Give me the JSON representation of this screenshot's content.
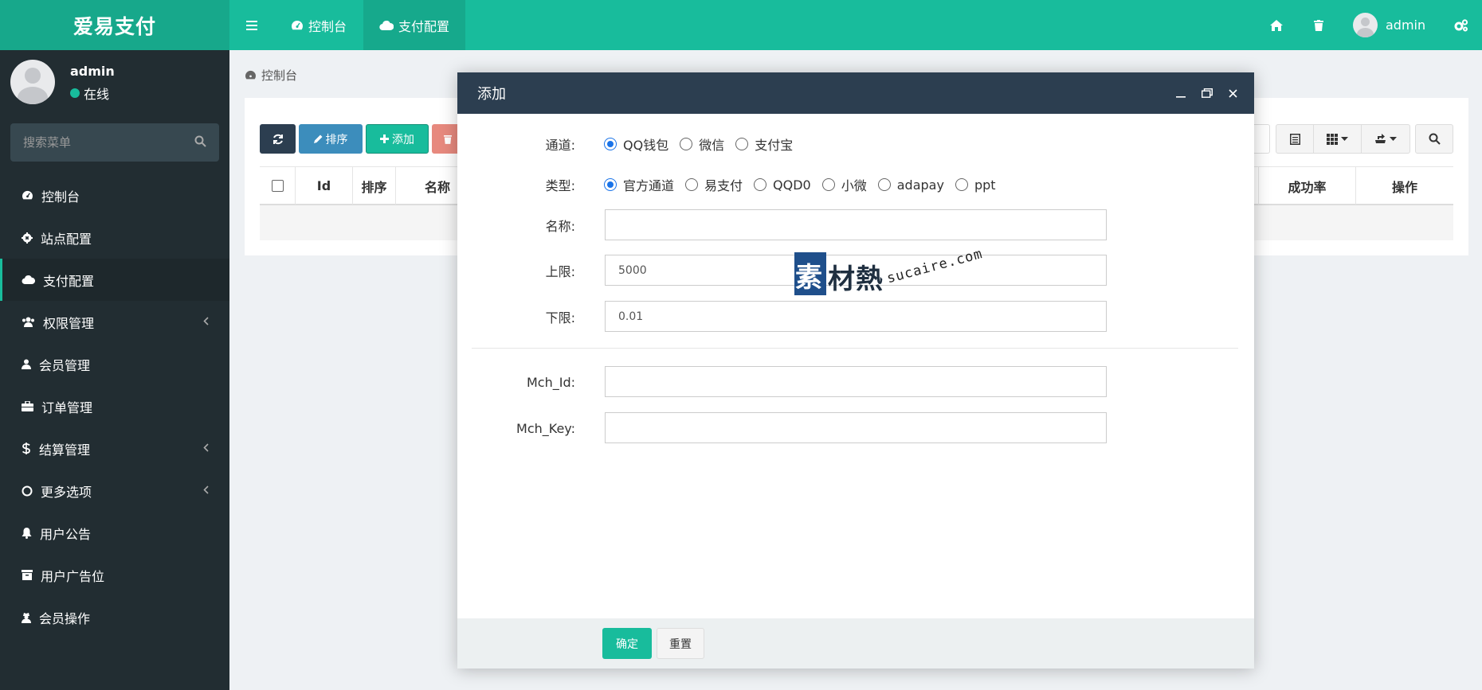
{
  "app": {
    "title": "爱易支付"
  },
  "topbar": {
    "tabs": [
      {
        "label": "控制台",
        "icon": "dashboard-icon"
      },
      {
        "label": "支付配置",
        "icon": "cloud-icon"
      }
    ],
    "user_name": "admin"
  },
  "sidebar": {
    "user_name": "admin",
    "status": "在线",
    "search_placeholder": "搜索菜单",
    "items": [
      {
        "label": "控制台",
        "icon": "dashboard-icon"
      },
      {
        "label": "站点配置",
        "icon": "gear-icon"
      },
      {
        "label": "支付配置",
        "icon": "cloud-icon",
        "active": true
      },
      {
        "label": "权限管理",
        "icon": "users-icon",
        "has_children": true
      },
      {
        "label": "会员管理",
        "icon": "user-icon"
      },
      {
        "label": "订单管理",
        "icon": "briefcase-icon"
      },
      {
        "label": "结算管理",
        "icon": "dollar-icon",
        "has_children": true
      },
      {
        "label": "更多选项",
        "icon": "circle-icon",
        "has_children": true
      },
      {
        "label": "用户公告",
        "icon": "bell-icon"
      },
      {
        "label": "用户广告位",
        "icon": "archive-icon"
      },
      {
        "label": "会员操作",
        "icon": "user-secret-icon"
      }
    ]
  },
  "breadcrumb": {
    "label": "控制台"
  },
  "toolbar": {
    "sort_label": "排序",
    "add_label": "添加"
  },
  "table": {
    "headers": [
      "Id",
      "排序",
      "名称",
      "成功率",
      "操作"
    ]
  },
  "modal": {
    "title": "添加",
    "channel": {
      "label": "通道:",
      "options": [
        "QQ钱包",
        "微信",
        "支付宝"
      ],
      "selected": "QQ钱包"
    },
    "type": {
      "label": "类型:",
      "options": [
        "官方通道",
        "易支付",
        "QQD0",
        "小微",
        "adapay",
        "ppt"
      ],
      "selected": "官方通道"
    },
    "name": {
      "label": "名称:",
      "value": ""
    },
    "upper": {
      "label": "上限:",
      "value": "5000"
    },
    "lower": {
      "label": "下限:",
      "value": "0.01"
    },
    "mch_id": {
      "label": "Mch_Id:",
      "value": ""
    },
    "mch_key": {
      "label": "Mch_Key:",
      "value": ""
    },
    "ok_label": "确定",
    "reset_label": "重置"
  },
  "watermark": {
    "cn": "素材熱",
    "en": "sucaire.com"
  },
  "colors": {
    "accent": "#18bc9c",
    "sidebar": "#222d32",
    "modal_header": "#2c3e50",
    "primary_blue": "#3c8dbc",
    "danger": "#e74c3c"
  }
}
